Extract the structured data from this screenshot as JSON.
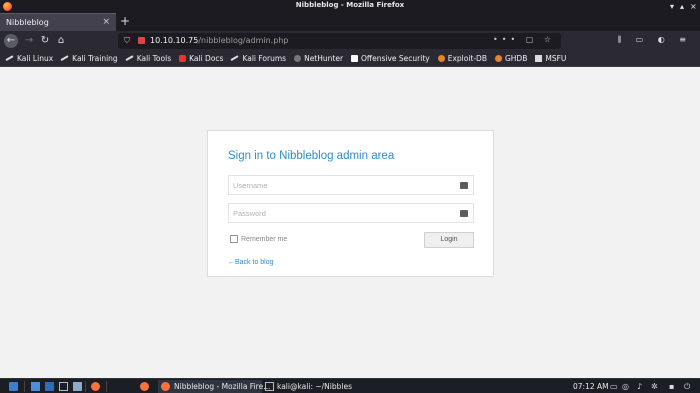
{
  "window": {
    "title": "Nibbleblog - Mozilla Firefox"
  },
  "tab": {
    "label": "Nibbleblog",
    "close": "×",
    "new_tab": "+"
  },
  "nav": {
    "back": "←",
    "forward": "→",
    "reload": "↻",
    "home": "⌂",
    "url_host": "10.10.10.75",
    "url_path": "/nibbleblog/admin.php",
    "url_actions": "••• ▢ ☆",
    "tools": "⫼ ▭ ◐ ≡"
  },
  "bookmarks": [
    {
      "label": "Kali Linux",
      "icon": "kali-dragon-icon"
    },
    {
      "label": "Kali Training",
      "icon": "kali-dragon-icon"
    },
    {
      "label": "Kali Tools",
      "icon": "kali-dragon-icon"
    },
    {
      "label": "Kali Docs",
      "icon": "kali-docs-icon"
    },
    {
      "label": "Kali Forums",
      "icon": "kali-dragon-icon"
    },
    {
      "label": "NetHunter",
      "icon": "nethunter-icon"
    },
    {
      "label": "Offensive Security",
      "icon": "offsec-icon"
    },
    {
      "label": "Exploit-DB",
      "icon": "exploitdb-icon"
    },
    {
      "label": "GHDB",
      "icon": "ghdb-icon"
    },
    {
      "label": "MSFU",
      "icon": "msfu-icon"
    }
  ],
  "login": {
    "heading": "Sign in to Nibbleblog admin area",
    "username_placeholder": "Username",
    "password_placeholder": "Password",
    "remember_label": "Remember me",
    "login_button": "Login",
    "back_link": "←Back to blog"
  },
  "taskbar": {
    "firefox_task": "Nibbleblog - Mozilla Fire...",
    "terminal_task": "kali@kali: ~/Nibbles",
    "clock": "07:12 AM"
  },
  "colors": {
    "accent": "#2e8ccf",
    "chrome_dark": "#1c1b22",
    "toolbar": "#2b2a33"
  }
}
